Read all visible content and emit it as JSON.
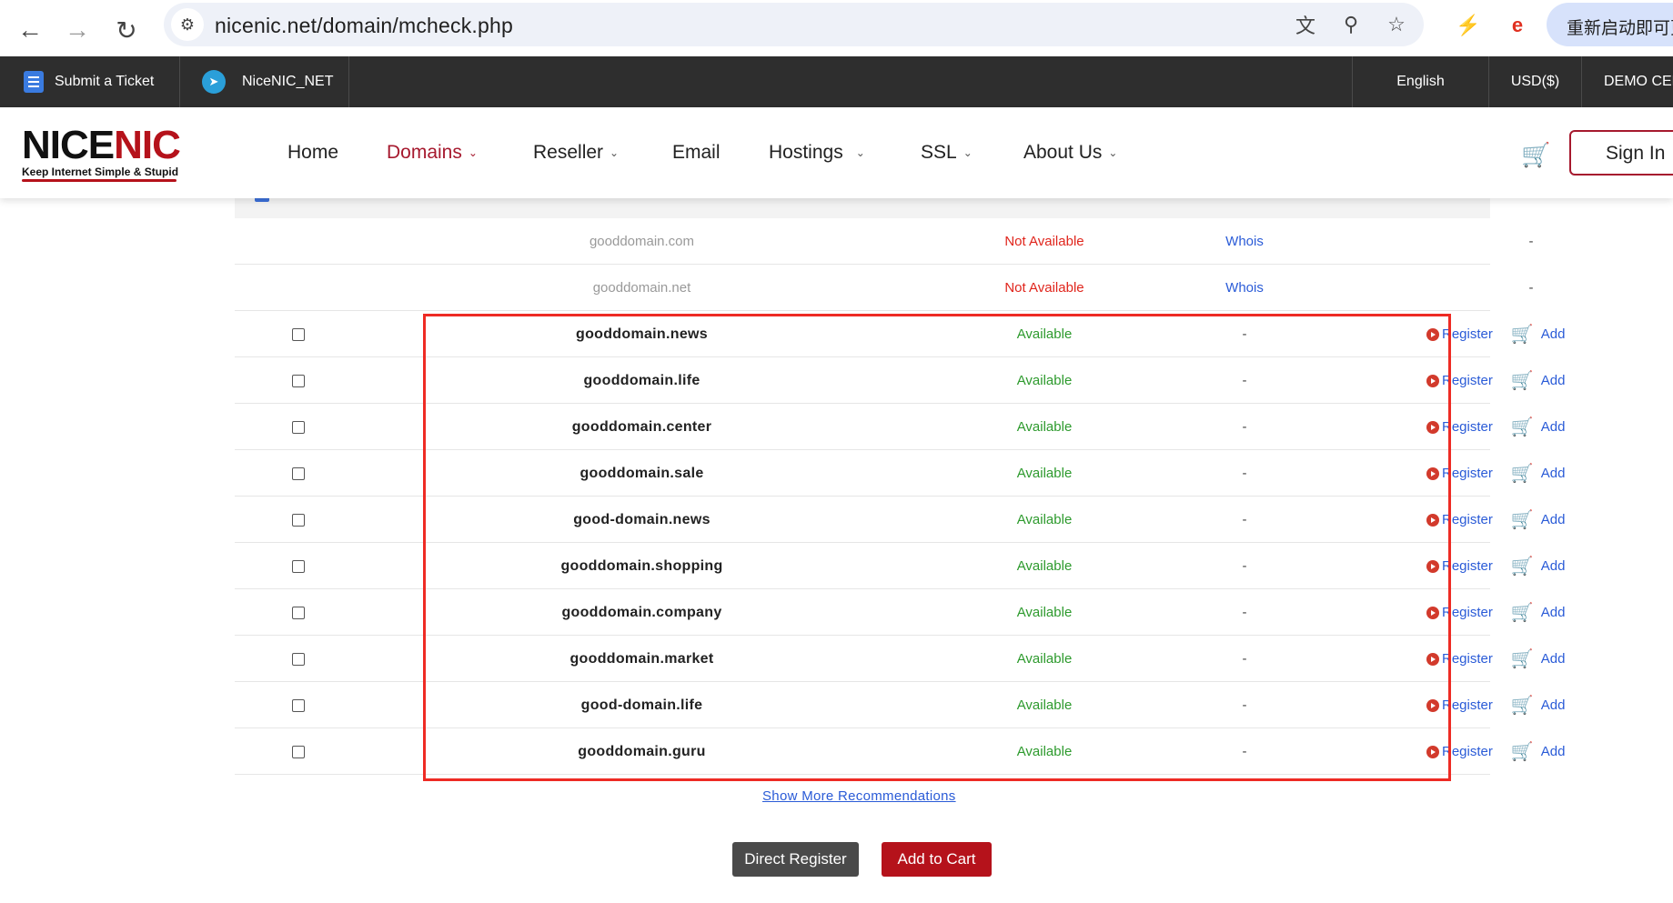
{
  "browser": {
    "url": "nicenic.net/domain/mcheck.php",
    "restart_label": "重新启动即可更新"
  },
  "topbar": {
    "ticket_label": "Submit a Ticket",
    "telegram_label": "NiceNIC_NET",
    "language": "English",
    "currency": "USD($)",
    "demo": "DEMO CENTER"
  },
  "header": {
    "logo_nice": "NICE",
    "logo_nic": "NIC",
    "logo_tagline": "Keep Internet Simple & Stupid",
    "menu": [
      {
        "label": "Home"
      },
      {
        "label": "Domains"
      },
      {
        "label": "Reseller"
      },
      {
        "label": "Email"
      },
      {
        "label": "Hostings"
      },
      {
        "label": "SSL"
      },
      {
        "label": "About Us"
      }
    ],
    "signin_label": "Sign In"
  },
  "unavailable_rows": [
    {
      "domain": "gooddomain.com",
      "status": "Not Available",
      "whois": "Whois",
      "action": "-"
    },
    {
      "domain": "gooddomain.net",
      "status": "Not Available",
      "whois": "Whois",
      "action": "-"
    }
  ],
  "available_rows": [
    {
      "domain": "gooddomain.news",
      "status": "Available",
      "whois": "-",
      "register": "Register",
      "add": "Add"
    },
    {
      "domain": "gooddomain.life",
      "status": "Available",
      "whois": "-",
      "register": "Register",
      "add": "Add"
    },
    {
      "domain": "gooddomain.center",
      "status": "Available",
      "whois": "-",
      "register": "Register",
      "add": "Add"
    },
    {
      "domain": "gooddomain.sale",
      "status": "Available",
      "whois": "-",
      "register": "Register",
      "add": "Add"
    },
    {
      "domain": "good-domain.news",
      "status": "Available",
      "whois": "-",
      "register": "Register",
      "add": "Add"
    },
    {
      "domain": "gooddomain.shopping",
      "status": "Available",
      "whois": "-",
      "register": "Register",
      "add": "Add"
    },
    {
      "domain": "gooddomain.company",
      "status": "Available",
      "whois": "-",
      "register": "Register",
      "add": "Add"
    },
    {
      "domain": "gooddomain.market",
      "status": "Available",
      "whois": "-",
      "register": "Register",
      "add": "Add"
    },
    {
      "domain": "good-domain.life",
      "status": "Available",
      "whois": "-",
      "register": "Register",
      "add": "Add"
    },
    {
      "domain": "gooddomain.guru",
      "status": "Available",
      "whois": "-",
      "register": "Register",
      "add": "Add"
    }
  ],
  "footer": {
    "more_label": "Show More Recommendations",
    "direct_register_label": "Direct Register",
    "add_to_cart_label": "Add to Cart"
  },
  "colors": {
    "brand_red": "#b5121b",
    "available_green": "#2d9a2d",
    "not_available_red": "#e0251c",
    "link_blue": "#2a5bd7",
    "highlight": "#ee2b24"
  }
}
